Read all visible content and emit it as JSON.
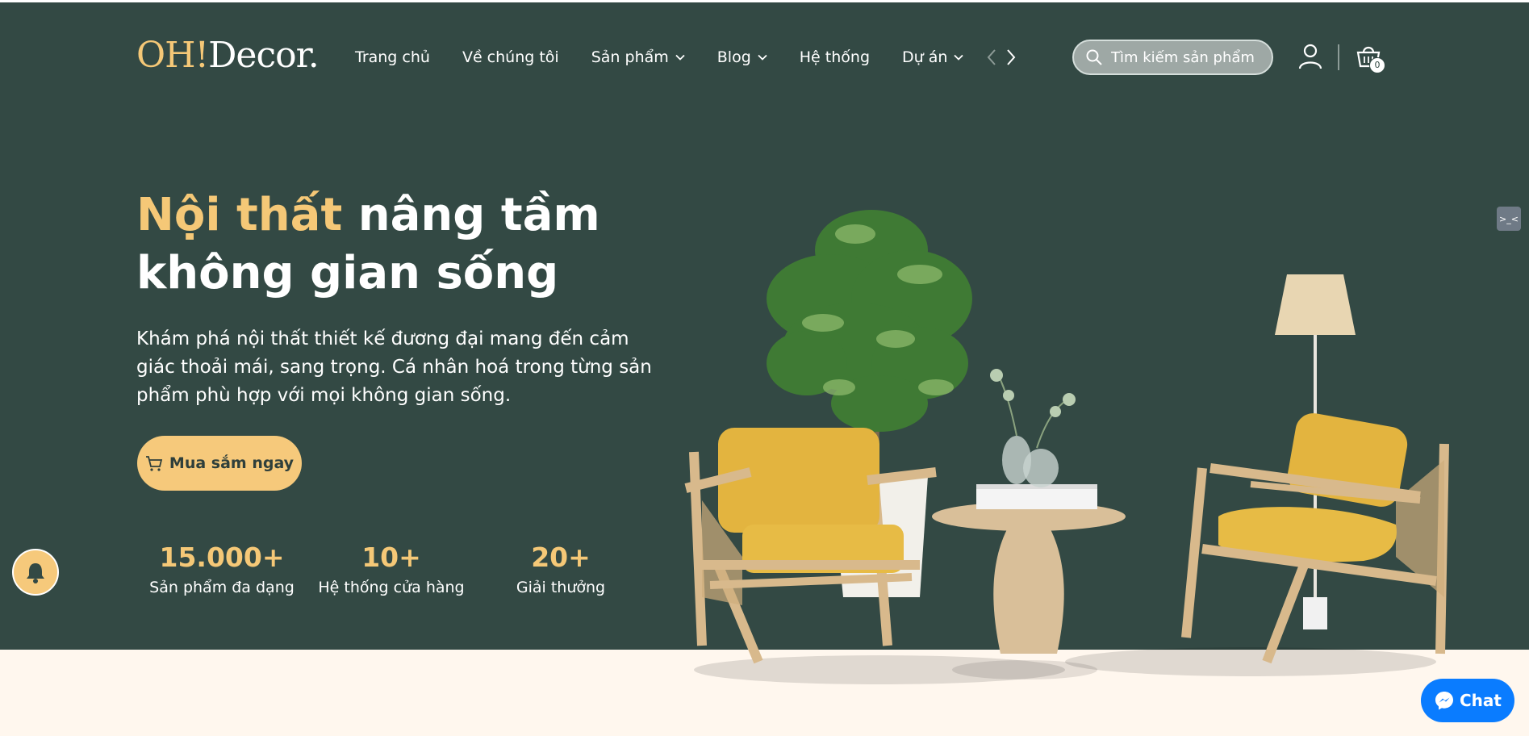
{
  "header": {
    "logo_main": "OH!",
    "logo_rest": "Decor.",
    "nav": [
      {
        "label": "Trang chủ",
        "has_dropdown": false
      },
      {
        "label": "Về chúng tôi",
        "has_dropdown": false
      },
      {
        "label": "Sản phẩm",
        "has_dropdown": true
      },
      {
        "label": "Blog",
        "has_dropdown": true
      },
      {
        "label": "Hệ thống",
        "has_dropdown": false
      },
      {
        "label": "Dự án",
        "has_dropdown": true
      }
    ],
    "search_placeholder": "Tìm kiếm sản phẩm",
    "cart_count": "0"
  },
  "hero": {
    "headline_highlight": "Nội thất",
    "headline_rest": " nâng tầm không gian sống",
    "description": "Khám phá nội thất thiết kế đương đại mang đến cảm giác thoải mái, sang trọng. Cá nhân hoá trong từng sản phẩm phù hợp với mọi không gian sống.",
    "cta_label": "Mua sắm ngay",
    "stats": [
      {
        "number": "15.000+",
        "label": "Sản phẩm đa dạng"
      },
      {
        "number": "10+",
        "label": "Hệ thống cửa hàng"
      },
      {
        "number": "20+",
        "label": "Giải thưởng"
      }
    ]
  },
  "widgets": {
    "chat_label": "Chat",
    "side_tab_text": ">_<"
  },
  "colors": {
    "hero_bg": "#334944",
    "accent": "#f5c877",
    "page_bg": "#fff7ee",
    "chat_blue": "#0a7cff"
  },
  "icons": [
    "search-icon",
    "user-icon",
    "cart-icon",
    "chevron-down-icon",
    "chevron-left-icon",
    "chevron-right-icon",
    "bell-icon",
    "messenger-icon"
  ]
}
